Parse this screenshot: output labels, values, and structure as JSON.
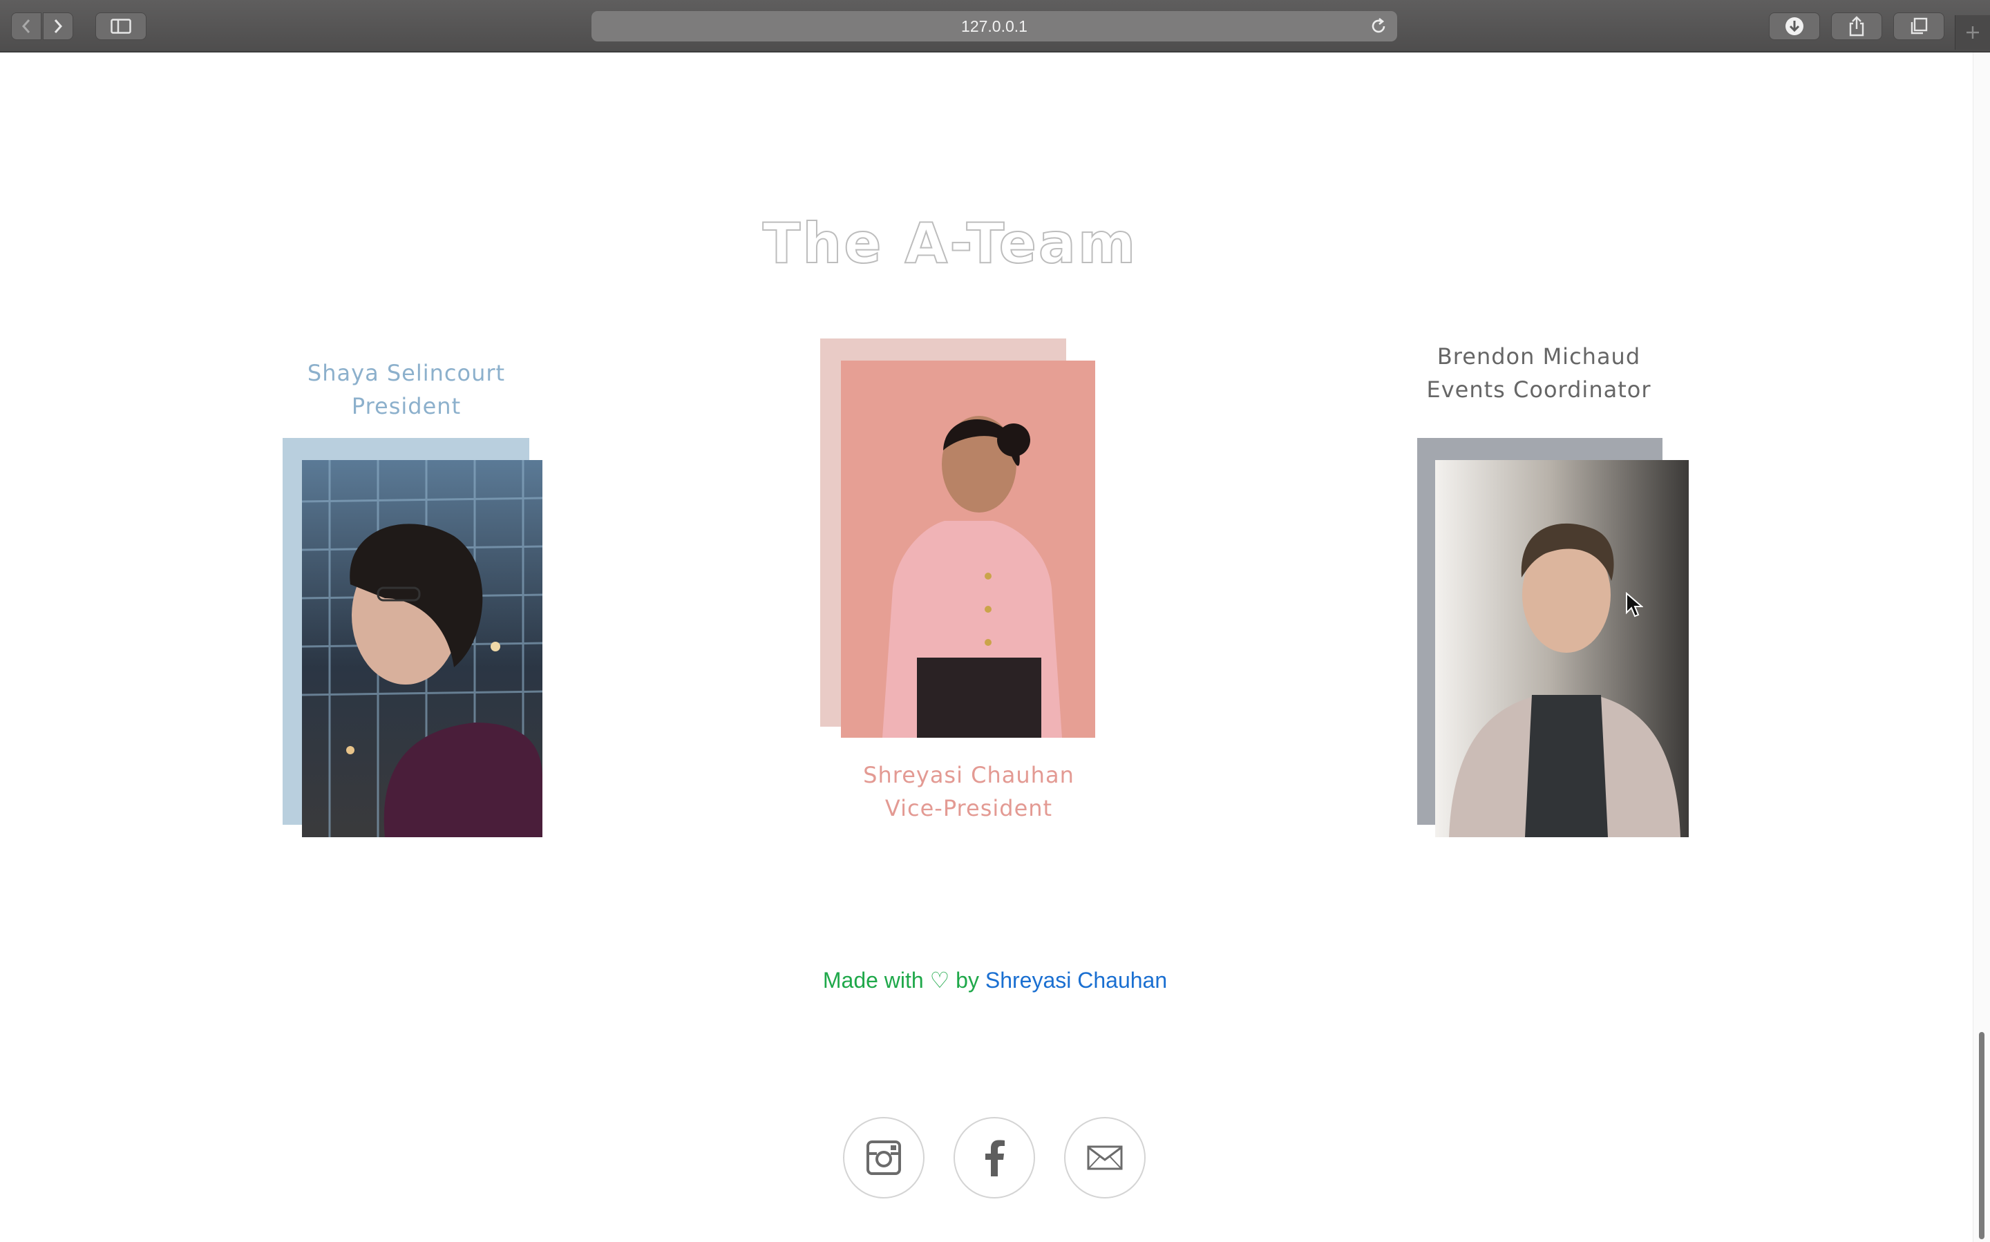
{
  "browser": {
    "url": "127.0.0.1"
  },
  "page": {
    "title": "The A-Team",
    "members": [
      {
        "name": "Shaya Selincourt",
        "role": "President",
        "color": "#8cb0cc",
        "frame_color": "#b9cfde"
      },
      {
        "name": "Shreyasi Chauhan",
        "role": "Vice-President",
        "color": "#e39a93",
        "frame_color": "#e9cbc6"
      },
      {
        "name": "Brendon Michaud",
        "role": "Events Coordinator",
        "color": "#666666",
        "frame_color": "#a3a7ae"
      }
    ],
    "footer": {
      "prefix": "Made with",
      "heart": "♡",
      "by": "by",
      "author": "Shreyasi Chauhan"
    },
    "social": [
      {
        "icon": "instagram-icon"
      },
      {
        "icon": "facebook-icon"
      },
      {
        "icon": "mail-icon"
      }
    ]
  }
}
